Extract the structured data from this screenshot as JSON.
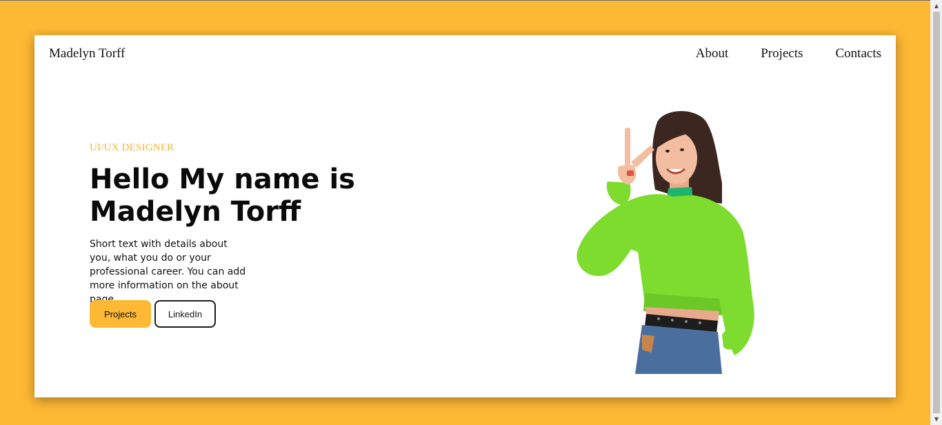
{
  "header": {
    "brand": "Madelyn Torff",
    "nav": [
      "About",
      "Projects",
      "Contacts"
    ]
  },
  "hero": {
    "eyebrow": "UI/UX DESIGNER",
    "headline_line1": "Hello My name is",
    "headline_line2": "Madelyn Torff",
    "blurb": "Short text with details about you, what you do or your professional career. You can add more information on the about page.",
    "primary_button": "Projects",
    "secondary_button": "LinkedIn"
  },
  "colors": {
    "accent": "#fdb834",
    "page_background": "#fdb834",
    "card_background": "#ffffff",
    "text": "#111111",
    "sweater": "#7ddc2e"
  }
}
